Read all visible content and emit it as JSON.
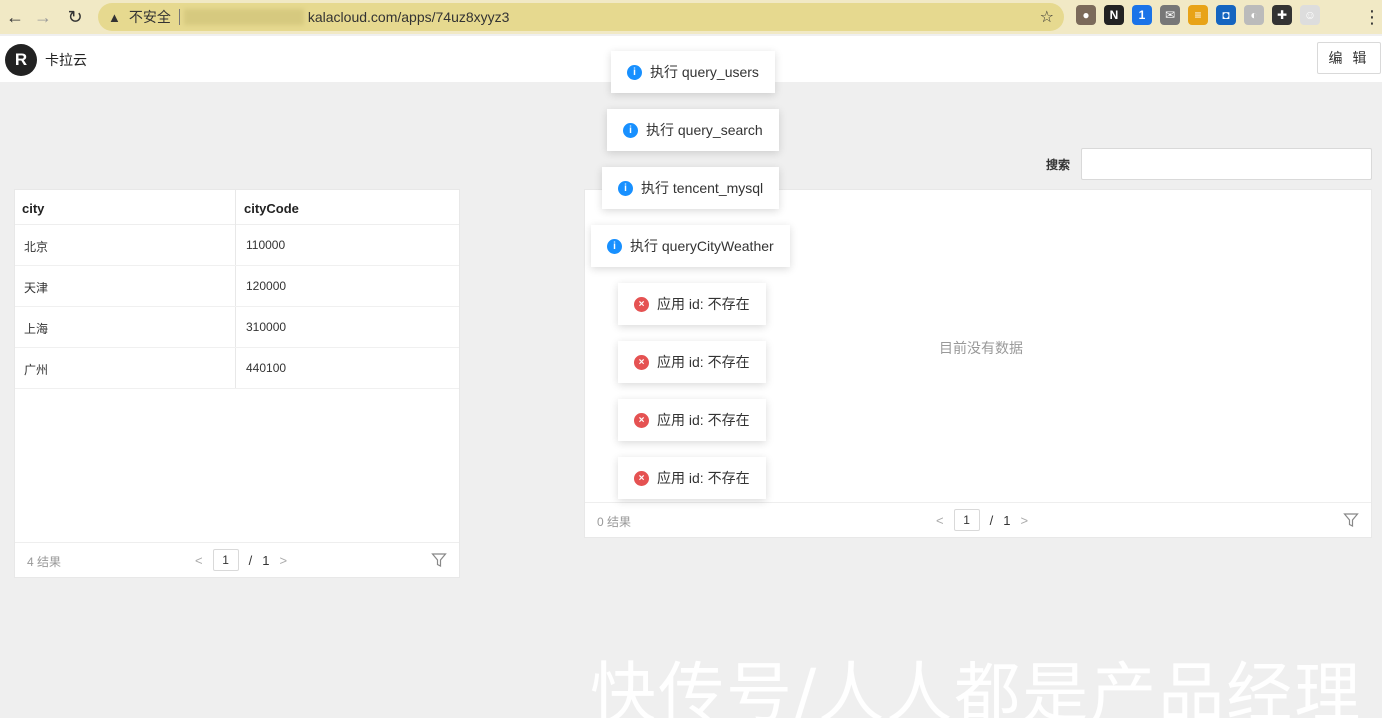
{
  "browser": {
    "insecure_label": "不安全",
    "url": "kalacloud.com/apps/74uz8xyyz3",
    "extensions": [
      {
        "name": "tomato-icon",
        "color": "#7b6a5a",
        "glyph": "●"
      },
      {
        "name": "notion-icon",
        "color": "#222222",
        "glyph": "N"
      },
      {
        "name": "onepassword-icon",
        "color": "#1a73e8",
        "glyph": "1"
      },
      {
        "name": "mail-icon",
        "color": "#777777",
        "glyph": "✉"
      },
      {
        "name": "grid-icon",
        "color": "#e8a317",
        "glyph": "≡"
      },
      {
        "name": "app-icon",
        "color": "#1565c0",
        "glyph": "◘"
      },
      {
        "name": "circle-icon",
        "color": "#bbbbbb",
        "glyph": "◐"
      },
      {
        "name": "puzzle-icon",
        "color": "#333333",
        "glyph": "✚"
      },
      {
        "name": "profile-icon",
        "color": "#dddddd",
        "glyph": "☺"
      }
    ]
  },
  "app": {
    "logo_letter": "R",
    "name": "卡拉云",
    "edit_label": "编 辑"
  },
  "left_table": {
    "columns": [
      "city",
      "cityCode"
    ],
    "rows": [
      {
        "city": "北京",
        "code": "110000"
      },
      {
        "city": "天津",
        "code": "120000"
      },
      {
        "city": "上海",
        "code": "310000"
      },
      {
        "city": "广州",
        "code": "440100"
      }
    ],
    "result_count": "4 结果",
    "page": "1",
    "page_sep": "/",
    "total_pages": "1"
  },
  "search": {
    "label": "搜索",
    "value": ""
  },
  "right_table": {
    "empty_text": "目前没有数据",
    "result_count": "0 结果",
    "page": "1",
    "page_sep": "/",
    "total_pages": "1"
  },
  "toasts": [
    {
      "type": "info",
      "text": "执行 query_users"
    },
    {
      "type": "info",
      "text": "执行 query_search"
    },
    {
      "type": "info",
      "text": "执行 tencent_mysql"
    },
    {
      "type": "info",
      "text": "执行 queryCityWeather"
    },
    {
      "type": "error",
      "text": "应用 id: 不存在"
    },
    {
      "type": "error",
      "text": "应用 id: 不存在"
    },
    {
      "type": "error",
      "text": "应用 id: 不存在"
    },
    {
      "type": "error",
      "text": "应用 id: 不存在"
    }
  ],
  "watermark": "快传号/人人都是产品经理"
}
